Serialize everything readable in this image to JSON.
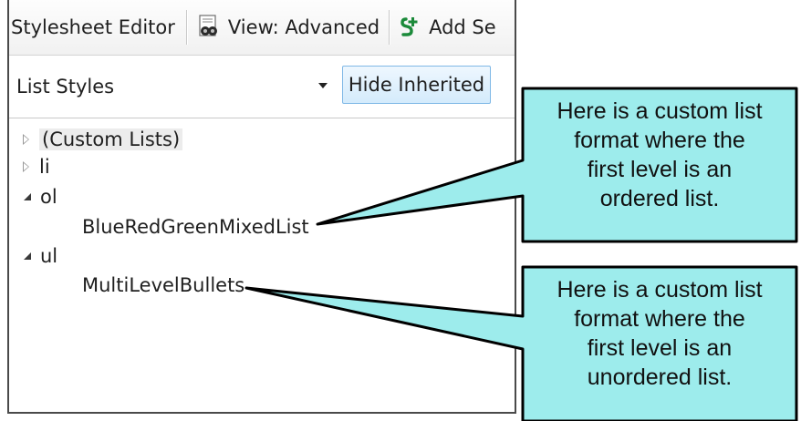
{
  "toolbar": {
    "title": "Stylesheet Editor",
    "view_label": "View: Advanced",
    "add_label": "Add Se"
  },
  "filter": {
    "dropdown_value": "List Styles",
    "hide_button": "Hide Inherited"
  },
  "tree": {
    "items": [
      {
        "label": "(Custom Lists)",
        "state": "collapsed"
      },
      {
        "label": "li",
        "state": "collapsed"
      },
      {
        "label": "ol",
        "state": "expanded"
      },
      {
        "label": "BlueRedGreenMixedList",
        "state": "leaf"
      },
      {
        "label": "ul",
        "state": "expanded"
      },
      {
        "label": "MultiLevelBullets",
        "state": "leaf"
      }
    ]
  },
  "callouts": [
    {
      "lines": [
        "Here is a custom list",
        "format where the",
        "first level is an",
        "ordered list."
      ]
    },
    {
      "lines": [
        "Here is a custom list",
        "format where the",
        "first level is an",
        "unordered list."
      ]
    }
  ],
  "colors": {
    "callout_fill": "#9DECEC",
    "callout_border": "#000000",
    "button_border": "#7FB8E6"
  },
  "icons": {
    "view": "view-advanced-icon",
    "add": "add-selector-icon",
    "dropdown": "chevron-down-icon"
  }
}
